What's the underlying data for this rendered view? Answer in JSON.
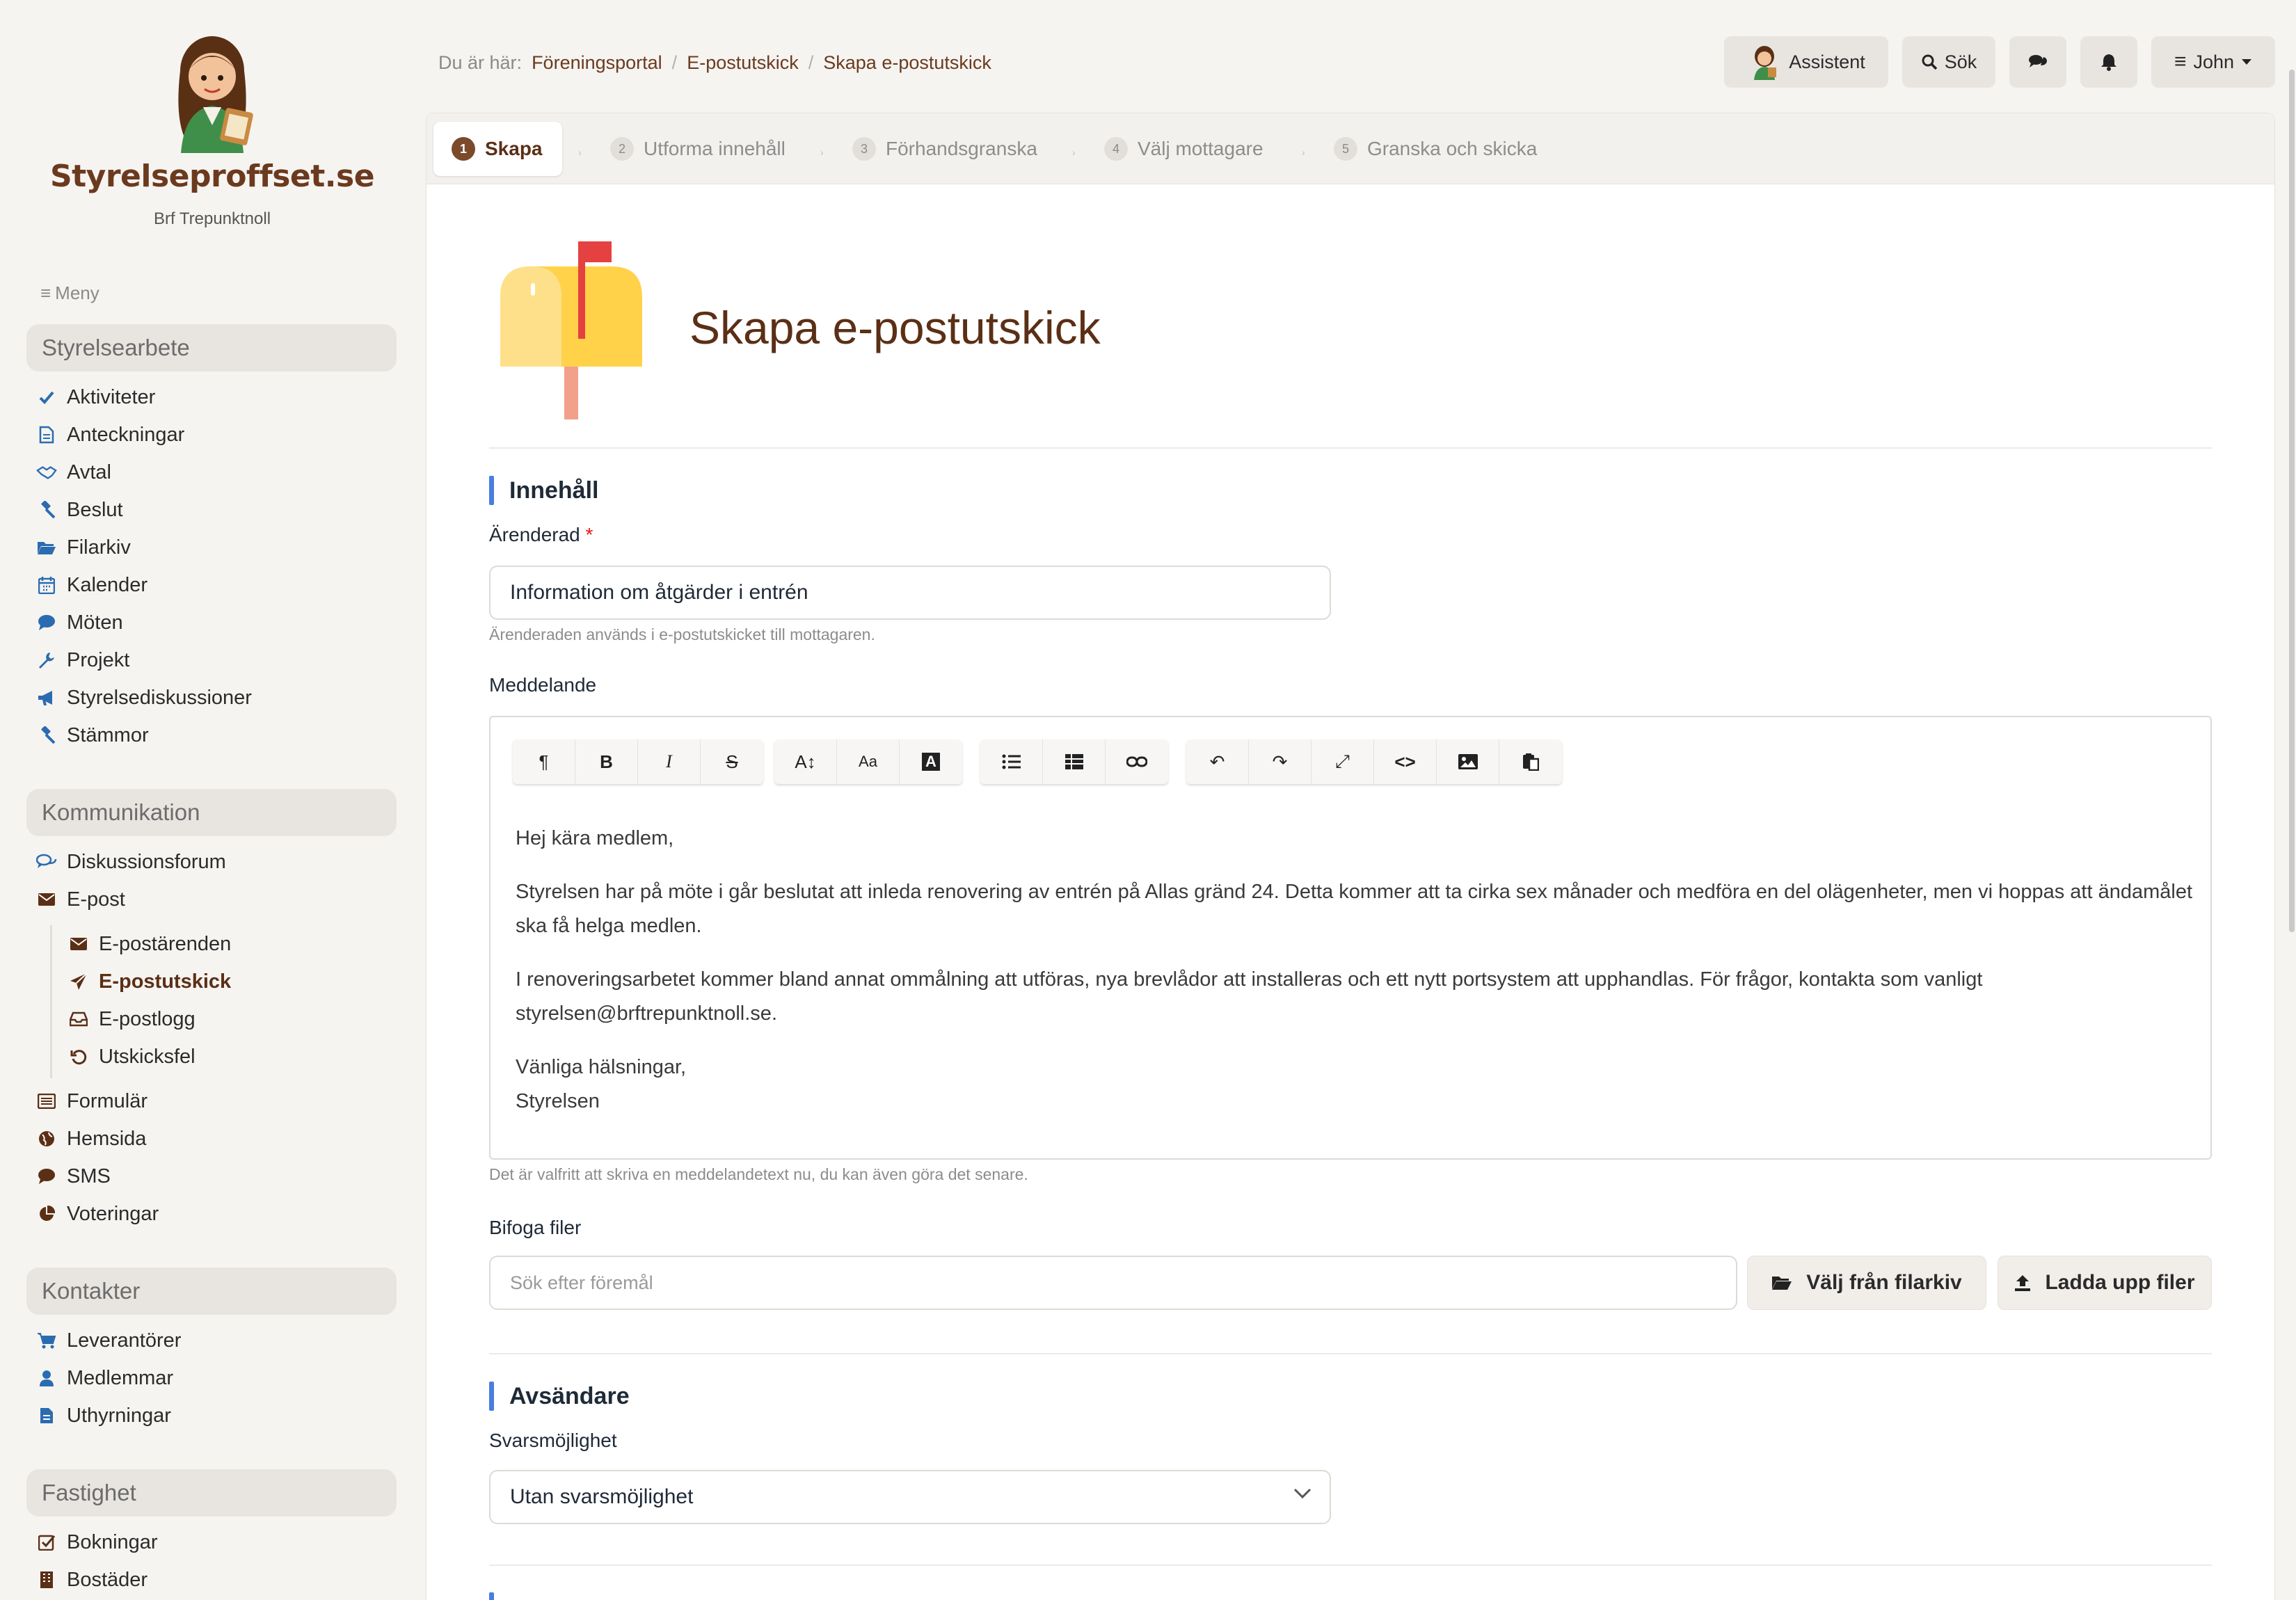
{
  "brand": {
    "name": "Styrelseproffset.se",
    "org": "Brf Trepunktnoll"
  },
  "menu_label": "Meny",
  "sidebar": {
    "sections": [
      {
        "title": "Styrelsearbete",
        "items": [
          "Aktiviteter",
          "Anteckningar",
          "Avtal",
          "Beslut",
          "Filarkiv",
          "Kalender",
          "Möten",
          "Projekt",
          "Styrelsediskussioner",
          "Stämmor"
        ]
      },
      {
        "title": "Kommunikation",
        "items": [
          "Diskussionsforum",
          "E-post",
          "E-postärenden",
          "E-postutskick",
          "E-postlogg",
          "Utskicksfel",
          "Formulär",
          "Hemsida",
          "SMS",
          "Voteringar"
        ]
      },
      {
        "title": "Kontakter",
        "items": [
          "Leverantörer",
          "Medlemmar",
          "Uthyrningar"
        ]
      },
      {
        "title": "Fastighet",
        "items": [
          "Bokningar",
          "Bostäder"
        ]
      }
    ]
  },
  "breadcrumb": {
    "prefix": "Du är här:",
    "items": [
      "Föreningsportal",
      "E-postutskick",
      "Skapa e-postutskick"
    ]
  },
  "topbar": {
    "assistant": "Assistent",
    "search": "Sök",
    "user": "John"
  },
  "steps": [
    {
      "num": "1",
      "label": "Skapa"
    },
    {
      "num": "2",
      "label": "Utforma innehåll"
    },
    {
      "num": "3",
      "label": "Förhandsgranska"
    },
    {
      "num": "4",
      "label": "Välj mottagare"
    },
    {
      "num": "5",
      "label": "Granska och skicka"
    }
  ],
  "page_title": "Skapa e-postutskick",
  "content": {
    "section_title": "Innehåll",
    "subject_label": "Ärenderad",
    "subject_required": "*",
    "subject_value": "Information om åtgärder i entrén",
    "subject_help": "Ärenderaden används i e-postutskicket till mottagaren.",
    "message_label": "Meddelande",
    "message": {
      "p1": "Hej kära medlem,",
      "p2": "Styrelsen har på möte i går beslutat att inleda renovering av entrén på Allas gränd 24. Detta kommer att ta cirka sex månader och medföra en del olägenheter, men vi hoppas att ändamålet ska få helga medlen.",
      "p3": "I renoveringsarbetet kommer bland annat ommålning att utföras, nya brevlådor att installeras och ett nytt portsystem att upphandlas. För frågor, kontakta som vanligt styrelsen@brftrepunktnoll.se.",
      "p4a": "Vänliga hälsningar,",
      "p4b": "Styrelsen"
    },
    "message_help": "Det är valfritt att skriva en meddelandetext nu, du kan även göra det senare.",
    "attach_label": "Bifoga filer",
    "attach_placeholder": "Sök efter föremål",
    "choose_from_archive": "Välj från filarkiv",
    "upload_files": "Ladda upp filer"
  },
  "sender": {
    "section_title": "Avsändare",
    "reply_label": "Svarsmöjlighet",
    "reply_value": "Utan svarsmöjlighet"
  },
  "colors": {
    "brand": "#6b3a1e",
    "accent": "#4a7de0",
    "required": "#e11111"
  }
}
